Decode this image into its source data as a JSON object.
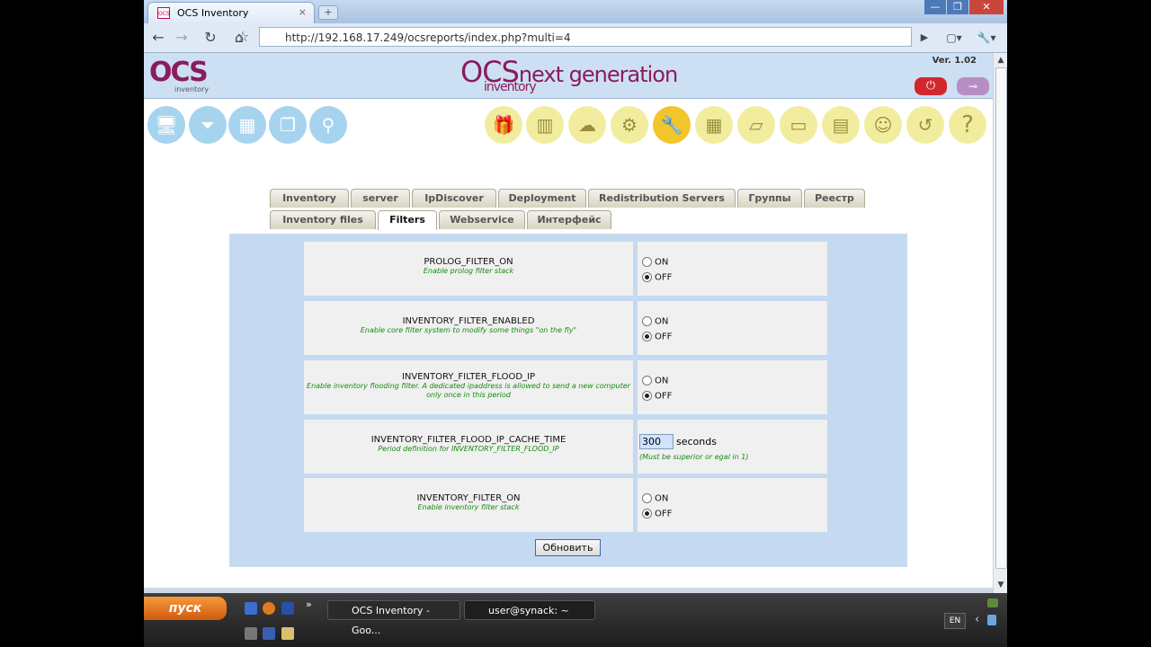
{
  "browser": {
    "tab_title": "OCS Inventory",
    "favicon_label": "OCS",
    "tab_close": "×",
    "new_tab": "+",
    "url": "http://192.168.17.249/ocsreports/index.php?multi=4",
    "back": "←",
    "forward": "→",
    "reload": "↻",
    "home": "⌂",
    "star": "☆",
    "go": "▶",
    "page_menu": "▢▾",
    "tools_menu": "🔧▾",
    "minimize": "—",
    "maximize": "❐",
    "close": "✕"
  },
  "header": {
    "logo_left": "OCS",
    "logo_left_sub": "inventory",
    "logo_center": "OCS",
    "logo_center_next": "next generation",
    "logo_center_sub": "inventory",
    "version": "Ver. 1.02",
    "power": "⏻",
    "key": "⊸"
  },
  "menu_icons": {
    "all_computers": "🖥",
    "filters": "⏷",
    "groups": "▦",
    "multi": "❐",
    "search": "⚲",
    "packages": "🎁",
    "firewall": "▥",
    "network": "☁",
    "settings": "⚙",
    "admin": "🔧",
    "registry": "▦",
    "dictionary": "▱",
    "software": "▭",
    "documents": "▤",
    "users": "☺",
    "restore": "↺",
    "help": "?"
  },
  "tabs_row1": [
    "Inventory",
    "server",
    "IpDiscover",
    "Deployment",
    "Redistribution Servers",
    "Группы",
    "Реестр"
  ],
  "tabs_row2": [
    "Inventory files",
    "Filters",
    "Webservice",
    "Интерфейс"
  ],
  "settings": [
    {
      "name": "PROLOG_FILTER_ON",
      "desc": "Enable prolog filter stack",
      "on": "ON",
      "off": "OFF",
      "selected": "OFF"
    },
    {
      "name": "INVENTORY_FILTER_ENABLED",
      "desc": "Enable core filter system to modify some things \"on the fly\"",
      "on": "ON",
      "off": "OFF",
      "selected": "OFF"
    },
    {
      "name": "INVENTORY_FILTER_FLOOD_IP",
      "desc": "Enable inventory flooding filter. A dedicated ipaddress is allowed to send a new computer only once in this period",
      "on": "ON",
      "off": "OFF",
      "selected": "OFF"
    },
    {
      "name": "INVENTORY_FILTER_FLOOD_IP_CACHE_TIME",
      "desc": "Period definition for INVENTORY_FILTER_FLOOD_IP",
      "value": "300",
      "unit": "seconds",
      "hint": "(Must be superior or egal in 1)"
    },
    {
      "name": "INVENTORY_FILTER_ON",
      "desc": "Enable inventory filter stack",
      "on": "ON",
      "off": "OFF",
      "selected": "OFF"
    }
  ],
  "update_button": "Обновить",
  "taskbar": {
    "start": "пуск",
    "overflow": "»",
    "task1": "OCS Inventory - Goo...",
    "task2": "user@synack: ~",
    "lang": "EN",
    "tray_chevron": "‹"
  }
}
